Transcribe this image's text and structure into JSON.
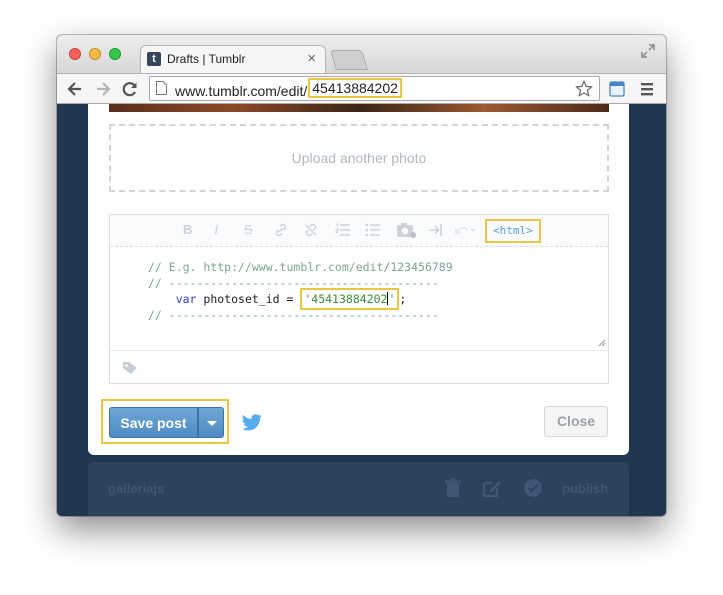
{
  "browser": {
    "tab_title": "Drafts | Tumblr",
    "tab_favicon_letter": "t",
    "url_prefix": "www.tumblr.com/edit/",
    "url_highlight": "45413884202"
  },
  "editor": {
    "upload_label": "Upload another photo",
    "format_buttons": [
      "B",
      "I",
      "S"
    ],
    "html_button": "<html>",
    "code": {
      "comment_line": "// E.g. http://www.tumblr.com/edit/123456789",
      "rule_line": "// ---------------------------------------",
      "keyword": "var",
      "statement": " photoset_id = ",
      "string_open": "'",
      "string_value": "45413884202",
      "string_close": "'",
      "terminator": ";"
    }
  },
  "actions": {
    "save_label": "Save post",
    "close_label": "Close"
  },
  "post": {
    "blog_name": "galleriajs",
    "publish_label": "publish"
  },
  "colors": {
    "accent": "#ecc640",
    "save_blue": "#5a96cb",
    "background": "#213650",
    "twitter": "#55acee"
  },
  "icons": [
    "back-icon",
    "forward-icon",
    "reload-icon",
    "page-icon",
    "star-icon",
    "extension-icon",
    "menu-icon",
    "tag-icon",
    "twitter-icon",
    "trash-icon",
    "edit-icon",
    "check-icon"
  ]
}
